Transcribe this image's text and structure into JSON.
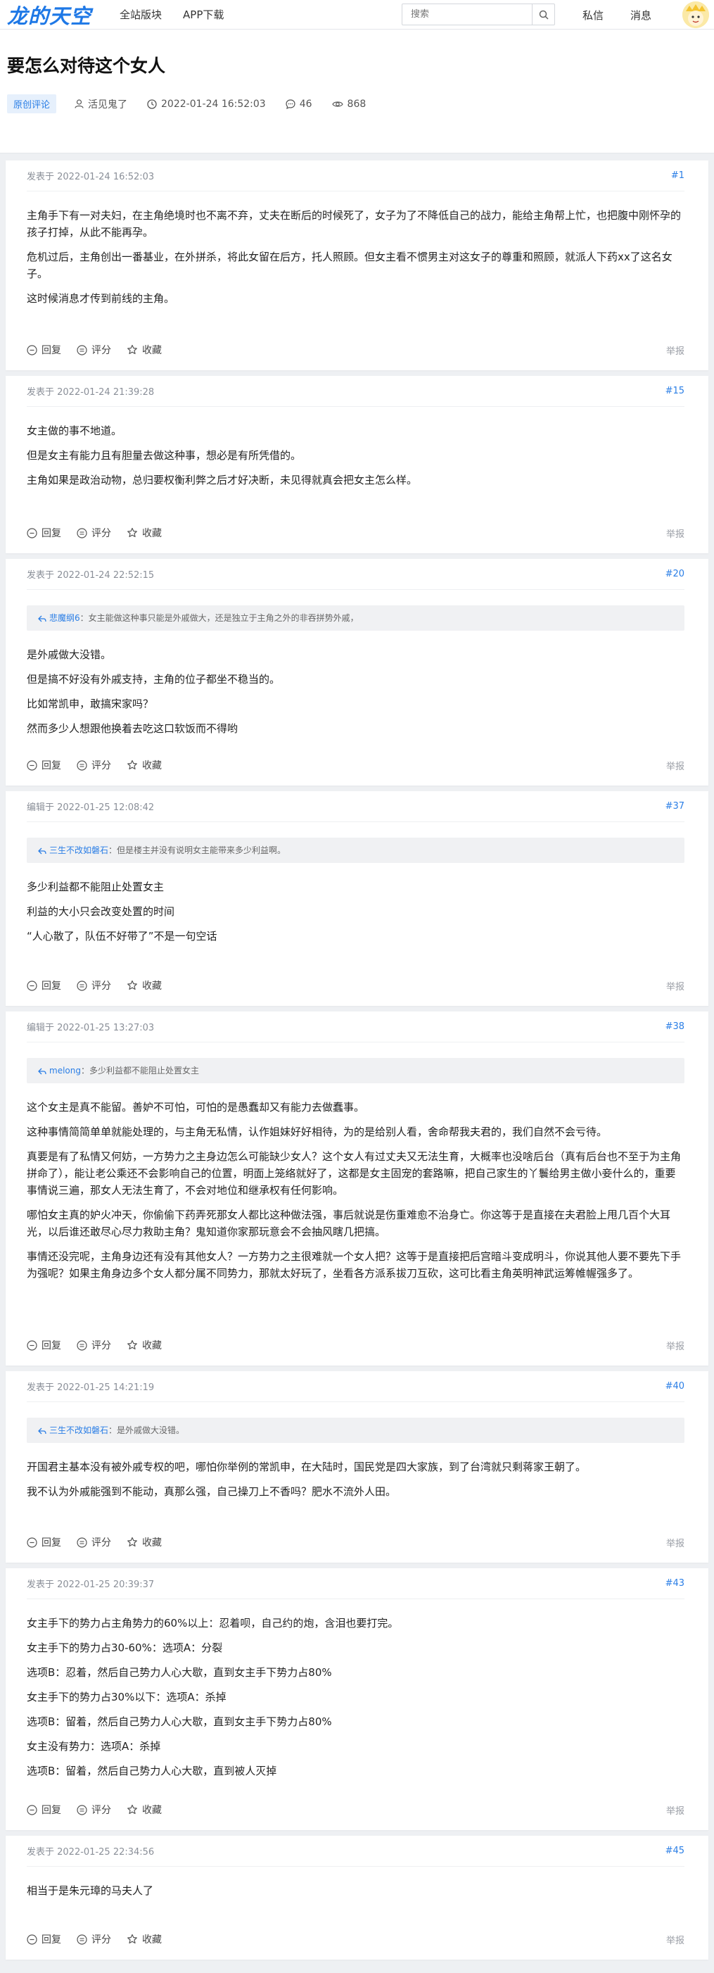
{
  "nav": {
    "logo": "龙的天空",
    "links": [
      "全站版块",
      "APP下载"
    ],
    "search_placeholder": "搜索",
    "right_links": [
      "私信",
      "消息"
    ]
  },
  "thread": {
    "title": "要怎么对待这个女人",
    "badge": "原创评论",
    "author": "活见鬼了",
    "time": "2022-01-24 16:52:03",
    "comments": "46",
    "views": "868"
  },
  "actions": {
    "reply": "回复",
    "rate": "评分",
    "favorite": "收藏",
    "report": "举报"
  },
  "posts": [
    {
      "time": "发表于 2022-01-24 16:52:03",
      "floor": "#1",
      "quote_user": "",
      "quote_text": "",
      "paragraphs": [
        "主角手下有一对夫妇，在主角绝境时也不离不弃，丈夫在断后的时候死了，女子为了不降低自己的战力，能给主角帮上忙，也把腹中刚怀孕的孩子打掉，从此不能再孕。",
        "危机过后，主角创出一番基业，在外拼杀，将此女留在后方，托人照顾。但女主看不惯男主对这女子的尊重和照顾，就派人下药xx了这名女子。",
        "这时候消息才传到前线的主角。"
      ]
    },
    {
      "time": "发表于 2022-01-24 21:39:28",
      "floor": "#15",
      "quote_user": "",
      "quote_text": "",
      "paragraphs": [
        "女主做的事不地道。",
        "但是女主有能力且有胆量去做这种事，想必是有所凭借的。",
        "主角如果是政治动物，总归要权衡利弊之后才好决断，未见得就真会把女主怎么样。"
      ]
    },
    {
      "time": "发表于 2022-01-24 22:52:15",
      "floor": "#20",
      "quote_user": "悲魔纲6",
      "quote_text": "：女主能做这种事只能是外戚做大，还是独立于主角之外的非吞拼势外戚，",
      "paragraphs": [
        "是外戚做大没错。",
        "但是搞不好没有外戚支持，主角的位子都坐不稳当的。",
        "比如常凯申，敢搞宋家吗？",
        "然而多少人想跟他换着去吃这口软饭而不得哟"
      ]
    },
    {
      "time": "编辑于 2022-01-25 12:08:42",
      "floor": "#37",
      "quote_user": "三生不改如磐石",
      "quote_text": "：但是楼主并没有说明女主能带来多少利益啊。",
      "paragraphs": [
        "多少利益都不能阻止处置女主",
        "利益的大小只会改变处置的时间",
        "“人心散了，队伍不好带了”不是一句空话"
      ]
    },
    {
      "time": "编辑于 2022-01-25 13:27:03",
      "floor": "#38",
      "quote_user": "melong",
      "quote_text": "：多少利益都不能阻止处置女主",
      "paragraphs": [
        "这个女主是真不能留。善妒不可怕，可怕的是愚蠢却又有能力去做蠢事。",
        "这种事情简简单单就能处理的，与主角无私情，认作姐妹好好相待，为的是给别人看，舍命帮我夫君的，我们自然不会亏待。",
        "真要是有了私情又何妨，一方势力之主身边怎么可能缺少女人？这个女人有过丈夫又无法生育，大概率也没啥后台（真有后台也不至于为主角拼命了），能让老公乘还不会影响自己的位置，明面上笼络就好了，这都是女主固宠的套路嘛，把自己家生的丫鬟给男主做小妾什么的，重要事情说三遍，那女人无法生育了，不会对地位和继承权有任何影响。",
        "哪怕女主真的妒火冲天，你偷偷下药弄死那女人都比这种做法强，事后就说是伤重难愈不治身亡。你这等于是直接在夫君脸上甩几百个大耳光，以后谁还敢尽心尽力救助主角？鬼知道你家那玩意会不会抽风瞎几把搞。",
        "事情还没完呢，主角身边还有没有其他女人？一方势力之主很难就一个女人把？这等于是直接把后宫暗斗变成明斗，你说其他人要不要先下手为强呢？如果主角身边多个女人都分属不同势力，那就太好玩了，坐看各方派系拔刀互砍，这可比看主角英明神武运筹帷幄强多了。"
      ]
    },
    {
      "time": "发表于 2022-01-25 14:21:19",
      "floor": "#40",
      "quote_user": "三生不改如磐石",
      "quote_text": "：是外戚做大没错。",
      "paragraphs": [
        "开国君主基本没有被外戚专权的吧，哪怕你举例的常凯申，在大陆时，国民党是四大家族，到了台湾就只剩蒋家王朝了。",
        "我不认为外戚能强到不能动，真那么强，自己操刀上不香吗？肥水不流外人田。"
      ]
    },
    {
      "time": "发表于 2022-01-25 20:39:37",
      "floor": "#43",
      "quote_user": "",
      "quote_text": "",
      "paragraphs": [
        "女主手下的势力占主角势力的60%以上：忍着呗，自己约的炮，含泪也要打完。",
        "女主手下的势力占30-60%：选项A：分裂",
        "选项B：忍着，然后自己势力人心大歇，直到女主手下势力占80%",
        "女主手下的势力占30%以下：选项A：杀掉",
        "选项B：留着，然后自己势力人心大歇，直到女主手下势力占80%",
        "女主没有势力：选项A：杀掉",
        "选项B：留着，然后自己势力人心大歇，直到被人灭掉"
      ]
    },
    {
      "time": "发表于 2022-01-25 22:34:56",
      "floor": "#45",
      "quote_user": "",
      "quote_text": "",
      "paragraphs": [
        "相当于是朱元璋的马夫人了"
      ]
    }
  ]
}
